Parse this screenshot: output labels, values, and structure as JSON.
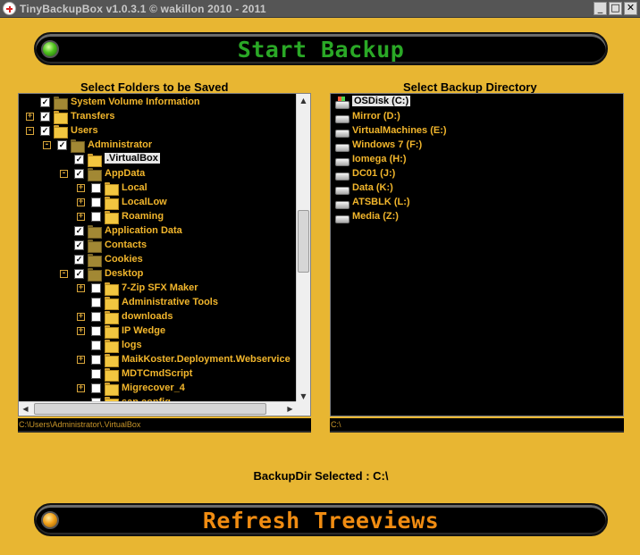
{
  "window": {
    "title": "TinyBackupBox v1.0.3.1 © wakillon 2010 - 2011",
    "controls": {
      "minimize": "_",
      "maximize": "□",
      "close": "✕"
    }
  },
  "buttons": {
    "start_backup": "Start  Backup",
    "refresh_treeviews": "Refresh Treeviews"
  },
  "colors": {
    "background": "#e8b632",
    "tree_text": "#f2b62c",
    "start_label": "#2aa826",
    "refresh_label": "#f08c12"
  },
  "source_tree": {
    "heading": "Select Folders to be Saved",
    "selected_path": "C:\\Users\\Administrator\\.VirtualBox",
    "nodes": [
      {
        "label": "System Volume Information",
        "expander": "",
        "checked": true,
        "icon": "folder-dark-icon"
      },
      {
        "label": "Transfers",
        "expander": "+",
        "checked": true,
        "icon": "folder-icon"
      },
      {
        "label": "Users",
        "expander": "-",
        "checked": true,
        "icon": "folder-icon"
      },
      {
        "label": "Administrator",
        "expander": "-",
        "checked": true,
        "icon": "user-folder-icon"
      },
      {
        "label": ".VirtualBox",
        "expander": "",
        "checked": true,
        "icon": "folder-icon",
        "selected": true
      },
      {
        "label": "AppData",
        "expander": "-",
        "checked": true,
        "icon": "folder-dark-icon"
      },
      {
        "label": "Local",
        "expander": "+",
        "checked": false,
        "icon": "folder-icon"
      },
      {
        "label": "LocalLow",
        "expander": "+",
        "checked": false,
        "icon": "folder-icon"
      },
      {
        "label": "Roaming",
        "expander": "+",
        "checked": false,
        "icon": "folder-icon"
      },
      {
        "label": "Application Data",
        "expander": "",
        "checked": true,
        "icon": "folder-dark-icon"
      },
      {
        "label": "Contacts",
        "expander": "",
        "checked": true,
        "icon": "contacts-folder-icon"
      },
      {
        "label": "Cookies",
        "expander": "",
        "checked": true,
        "icon": "folder-dark-icon"
      },
      {
        "label": "Desktop",
        "expander": "-",
        "checked": true,
        "icon": "desktop-folder-icon"
      },
      {
        "label": "7-Zip SFX Maker",
        "expander": "+",
        "checked": false,
        "icon": "folder-icon"
      },
      {
        "label": "Administrative Tools",
        "expander": "",
        "checked": false,
        "icon": "folder-icon"
      },
      {
        "label": "downloads",
        "expander": "+",
        "checked": false,
        "icon": "folder-icon"
      },
      {
        "label": "IP Wedge",
        "expander": "+",
        "checked": false,
        "icon": "folder-icon"
      },
      {
        "label": "logs",
        "expander": "",
        "checked": false,
        "icon": "folder-icon"
      },
      {
        "label": "MaikKoster.Deployment.Webservice",
        "expander": "+",
        "checked": false,
        "icon": "folder-icon"
      },
      {
        "label": "MDTCmdScript",
        "expander": "",
        "checked": false,
        "icon": "folder-icon"
      },
      {
        "label": "Migrecover_4",
        "expander": "+",
        "checked": false,
        "icon": "folder-icon"
      },
      {
        "label": "sap config",
        "expander": "",
        "checked": false,
        "icon": "folder-icon"
      }
    ]
  },
  "target_tree": {
    "heading": "Select Backup Directory",
    "selected_path": "C:\\",
    "drives": [
      {
        "label": "OSDisk (C:)",
        "selected": true,
        "icon": "windows-drive-icon"
      },
      {
        "label": "Mirror (D:)",
        "icon": "drive-icon"
      },
      {
        "label": "VirtualMachines (E:)",
        "icon": "drive-icon"
      },
      {
        "label": "Windows 7  (F:)",
        "icon": "drive-icon"
      },
      {
        "label": "Iomega (H:)",
        "icon": "drive-icon"
      },
      {
        "label": "DC01 (J:)",
        "icon": "drive-icon"
      },
      {
        "label": "Data (K:)",
        "icon": "drive-icon"
      },
      {
        "label": "ATSBLK (L:)",
        "icon": "network-drive-icon"
      },
      {
        "label": "Media (Z:)",
        "icon": "network-drive-icon"
      }
    ]
  },
  "status": {
    "backup_dir_label": "BackupDir Selected : C:\\"
  }
}
